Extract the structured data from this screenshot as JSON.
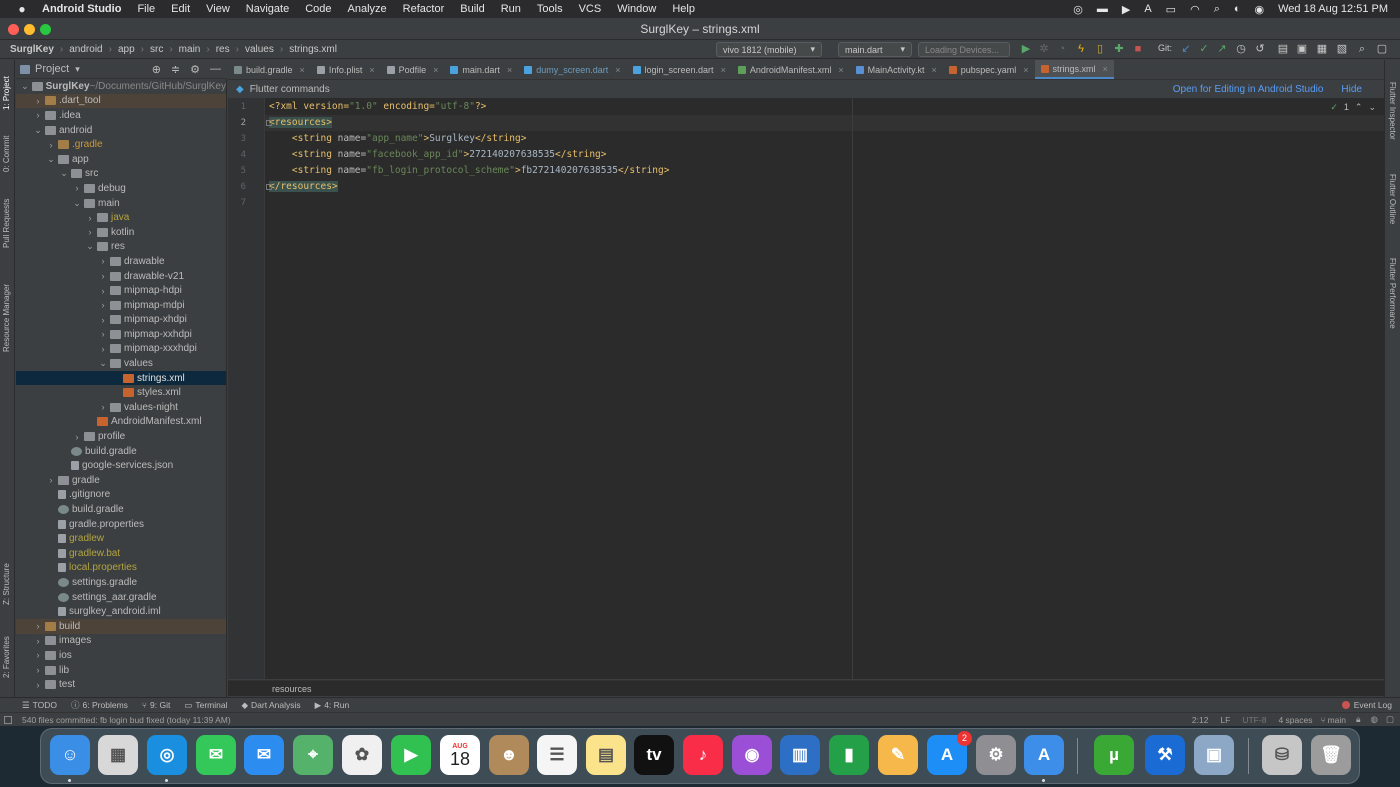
{
  "mac_menubar": {
    "app_name": "Android Studio",
    "menus": [
      "File",
      "Edit",
      "View",
      "Navigate",
      "Code",
      "Analyze",
      "Refactor",
      "Build",
      "Run",
      "Tools",
      "VCS",
      "Window",
      "Help"
    ],
    "clock": "Wed 18 Aug  12:51 PM"
  },
  "window": {
    "title": "SurglKey – strings.xml"
  },
  "navbar": {
    "breadcrumbs": [
      "SurglKey",
      "android",
      "app",
      "src",
      "main",
      "res",
      "values",
      "strings.xml"
    ],
    "device_select": "vivo 1812 (mobile)",
    "run_config": "main.dart",
    "devices_status": "Loading Devices...",
    "git_label": "Git:"
  },
  "left_strip": {
    "labels": [
      "1: Project",
      "0: Commit",
      "Pull Requests",
      "Resource Manager",
      "Z: Structure",
      "2: Favorites"
    ]
  },
  "right_strip": {
    "labels": [
      "Flutter Inspector",
      "Flutter Outline",
      "Flutter Performance"
    ]
  },
  "project_panel": {
    "title": "Project"
  },
  "tree": [
    {
      "label": "SurglKey",
      "suffix": " ~/Documents/GitHub/SurglKey",
      "indent": 0,
      "arrow": "open",
      "icon": "folder",
      "bold": true
    },
    {
      "label": ".dart_tool",
      "indent": 1,
      "arrow": "closed",
      "icon": "ofolder",
      "style": "excl"
    },
    {
      "label": ".idea",
      "indent": 1,
      "arrow": "closed",
      "icon": "folder"
    },
    {
      "label": "android",
      "indent": 1,
      "arrow": "open",
      "icon": "folder"
    },
    {
      "label": ".gradle",
      "indent": 2,
      "arrow": "closed",
      "icon": "ofolder",
      "color": "ora"
    },
    {
      "label": "app",
      "indent": 2,
      "arrow": "open",
      "icon": "folder"
    },
    {
      "label": "src",
      "indent": 3,
      "arrow": "open",
      "icon": "folder"
    },
    {
      "label": "debug",
      "indent": 4,
      "arrow": "closed",
      "icon": "folder"
    },
    {
      "label": "main",
      "indent": 4,
      "arrow": "open",
      "icon": "folder"
    },
    {
      "label": "java",
      "indent": 5,
      "arrow": "closed",
      "icon": "folder",
      "color": "yel"
    },
    {
      "label": "kotlin",
      "indent": 5,
      "arrow": "closed",
      "icon": "folder"
    },
    {
      "label": "res",
      "indent": 5,
      "arrow": "open",
      "icon": "folder"
    },
    {
      "label": "drawable",
      "indent": 6,
      "arrow": "closed",
      "icon": "folder"
    },
    {
      "label": "drawable-v21",
      "indent": 6,
      "arrow": "closed",
      "icon": "folder"
    },
    {
      "label": "mipmap-hdpi",
      "indent": 6,
      "arrow": "closed",
      "icon": "folder"
    },
    {
      "label": "mipmap-mdpi",
      "indent": 6,
      "arrow": "closed",
      "icon": "folder"
    },
    {
      "label": "mipmap-xhdpi",
      "indent": 6,
      "arrow": "closed",
      "icon": "folder"
    },
    {
      "label": "mipmap-xxhdpi",
      "indent": 6,
      "arrow": "closed",
      "icon": "folder"
    },
    {
      "label": "mipmap-xxxhdpi",
      "indent": 6,
      "arrow": "closed",
      "icon": "folder"
    },
    {
      "label": "values",
      "indent": 6,
      "arrow": "open",
      "icon": "folder"
    },
    {
      "label": "strings.xml",
      "indent": 7,
      "arrow": "none",
      "icon": "xml",
      "style": "sel"
    },
    {
      "label": "styles.xml",
      "indent": 7,
      "arrow": "none",
      "icon": "xml"
    },
    {
      "label": "values-night",
      "indent": 6,
      "arrow": "closed",
      "icon": "folder"
    },
    {
      "label": "AndroidManifest.xml",
      "indent": 5,
      "arrow": "none",
      "icon": "xml"
    },
    {
      "label": "profile",
      "indent": 4,
      "arrow": "closed",
      "icon": "folder"
    },
    {
      "label": "build.gradle",
      "indent": 3,
      "arrow": "none",
      "icon": "gr"
    },
    {
      "label": "google-services.json",
      "indent": 3,
      "arrow": "none",
      "icon": "file"
    },
    {
      "label": "gradle",
      "indent": 2,
      "arrow": "closed",
      "icon": "folder"
    },
    {
      "label": ".gitignore",
      "indent": 2,
      "arrow": "none",
      "icon": "file"
    },
    {
      "label": "build.gradle",
      "indent": 2,
      "arrow": "none",
      "icon": "gr"
    },
    {
      "label": "gradle.properties",
      "indent": 2,
      "arrow": "none",
      "icon": "file"
    },
    {
      "label": "gradlew",
      "indent": 2,
      "arrow": "none",
      "icon": "file",
      "color": "yel"
    },
    {
      "label": "gradlew.bat",
      "indent": 2,
      "arrow": "none",
      "icon": "file",
      "color": "yel"
    },
    {
      "label": "local.properties",
      "indent": 2,
      "arrow": "none",
      "icon": "file",
      "color": "yel"
    },
    {
      "label": "settings.gradle",
      "indent": 2,
      "arrow": "none",
      "icon": "gr"
    },
    {
      "label": "settings_aar.gradle",
      "indent": 2,
      "arrow": "none",
      "icon": "gr"
    },
    {
      "label": "surglkey_android.iml",
      "indent": 2,
      "arrow": "none",
      "icon": "file"
    },
    {
      "label": "build",
      "indent": 1,
      "arrow": "closed",
      "icon": "ofolder",
      "style": "excl"
    },
    {
      "label": "images",
      "indent": 1,
      "arrow": "closed",
      "icon": "folder"
    },
    {
      "label": "ios",
      "indent": 1,
      "arrow": "closed",
      "icon": "folder"
    },
    {
      "label": "lib",
      "indent": 1,
      "arrow": "closed",
      "icon": "folder"
    },
    {
      "label": "test",
      "indent": 1,
      "arrow": "closed",
      "icon": "folder"
    }
  ],
  "tabs": [
    {
      "label": "build.gradle",
      "color": "#7a8a8a"
    },
    {
      "label": "Info.plist",
      "color": "#9aa0a6"
    },
    {
      "label": "Podfile",
      "color": "#9aa0a6"
    },
    {
      "label": "main.dart",
      "color": "#4aa3df"
    },
    {
      "label": "dumy_screen.dart",
      "color": "#4aa3df",
      "text_color": "#6d9cbe"
    },
    {
      "label": "login_screen.dart",
      "color": "#4aa3df"
    },
    {
      "label": "AndroidManifest.xml",
      "color": "#5f9e5a"
    },
    {
      "label": "MainActivity.kt",
      "color": "#5a8fd6"
    },
    {
      "label": "pubspec.yaml",
      "color": "#c7632f"
    },
    {
      "label": "strings.xml",
      "color": "#c7632f",
      "active": true
    }
  ],
  "flutter_bar": {
    "title": "Flutter commands",
    "open_link": "Open for Editing in Android Studio",
    "hide_link": "Hide"
  },
  "inspection": {
    "count": "1"
  },
  "editor": {
    "line_numbers": [
      "1",
      "2",
      "3",
      "4",
      "5",
      "6",
      "7"
    ],
    "lines": [
      [
        {
          "t": "<?xml version=",
          "c": "pi"
        },
        {
          "t": "\"1.0\"",
          "c": "val"
        },
        {
          "t": " encoding=",
          "c": "pi"
        },
        {
          "t": "\"utf-8\"",
          "c": "val"
        },
        {
          "t": "?>",
          "c": "pi"
        }
      ],
      [
        {
          "t": "<resources>",
          "c": "tag"
        }
      ],
      [
        {
          "t": "    <string ",
          "c": "tag"
        },
        {
          "t": "name=",
          "c": "attr"
        },
        {
          "t": "\"app_name\"",
          "c": "val"
        },
        {
          "t": ">",
          "c": "tag"
        },
        {
          "t": "Surglkey",
          "c": "text"
        },
        {
          "t": "</string>",
          "c": "tag"
        }
      ],
      [
        {
          "t": "    <string ",
          "c": "tag"
        },
        {
          "t": "name=",
          "c": "attr"
        },
        {
          "t": "\"facebook_app_id\"",
          "c": "val"
        },
        {
          "t": ">",
          "c": "tag"
        },
        {
          "t": "272140207638535",
          "c": "text"
        },
        {
          "t": "</string>",
          "c": "tag"
        }
      ],
      [
        {
          "t": "    <string ",
          "c": "tag"
        },
        {
          "t": "name=",
          "c": "attr"
        },
        {
          "t": "\"fb_login_protocol_scheme\"",
          "c": "val"
        },
        {
          "t": ">",
          "c": "tag"
        },
        {
          "t": "fb272140207638535",
          "c": "text"
        },
        {
          "t": "</string>",
          "c": "tag"
        }
      ],
      [
        {
          "t": "</resources>",
          "c": "tag"
        }
      ],
      []
    ],
    "breadcrumb": "resources"
  },
  "toolwindows": [
    "TODO",
    "6: Problems",
    "9: Git",
    "Terminal",
    "Dart Analysis",
    "4: Run"
  ],
  "event_log": "Event Log",
  "status": {
    "message": "540 files committed: fb login bud fixed (today 11:39 AM)",
    "position": "2:12",
    "line_sep": "LF",
    "encoding": "UTF-8",
    "indent": "4 spaces",
    "branch": "main"
  },
  "dock": {
    "calendar_month": "AUG",
    "calendar_day": "18",
    "appstore_badge": "2",
    "apps": [
      "Finder",
      "Launchpad",
      "Safari",
      "Messages",
      "Mail",
      "Maps",
      "Photos",
      "FaceTime",
      "Calendar",
      "Contacts",
      "Reminders",
      "Notes",
      "TV",
      "Music",
      "Podcasts",
      "Keynote",
      "Numbers",
      "Pages",
      "App Store",
      "System Preferences",
      "Android Studio",
      "uTorrent",
      "Xcode",
      "Preview",
      "Disk Utility",
      "Trash"
    ]
  }
}
